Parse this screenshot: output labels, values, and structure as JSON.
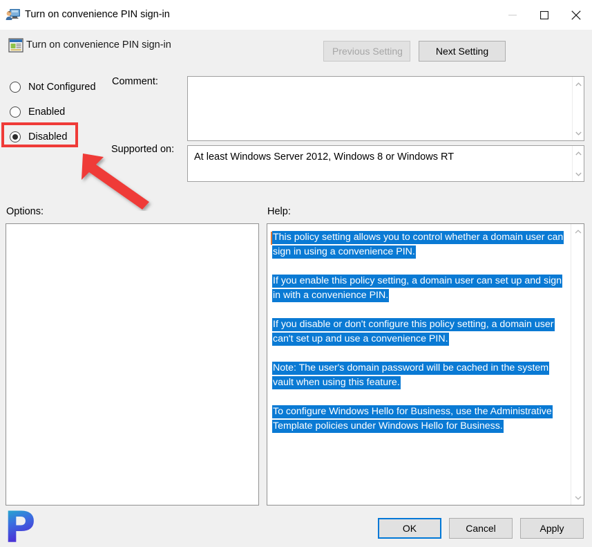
{
  "window": {
    "title": "Turn on convenience PIN sign-in",
    "icon": "policy-user-monitor-icon",
    "controls": {
      "minimize": "minimize-icon",
      "maximize": "maximize-icon",
      "close": "close-icon"
    }
  },
  "header": {
    "icon": "policy-setting-icon",
    "title": "Turn on convenience PIN sign-in",
    "previous_setting_label": "Previous Setting",
    "next_setting_label": "Next Setting",
    "previous_setting_enabled": false,
    "next_setting_enabled": true
  },
  "state_options": [
    {
      "label": "Not Configured",
      "selected": false
    },
    {
      "label": "Enabled",
      "selected": false
    },
    {
      "label": "Disabled",
      "selected": true
    }
  ],
  "fields": {
    "comment_label": "Comment:",
    "comment_value": "",
    "supported_on_label": "Supported on:",
    "supported_on_value": "At least Windows Server 2012, Windows 8 or Windows RT"
  },
  "panels": {
    "options_label": "Options:",
    "options_content": "",
    "help_label": "Help:"
  },
  "help_paragraphs": [
    "This policy setting allows you to control whether a domain user can sign in using a convenience PIN.",
    "If you enable this policy setting, a domain user can set up and sign in with a convenience PIN.",
    "If you disable or don't configure this policy setting, a domain user can't set up and use a convenience PIN.",
    "Note: The user's domain password will be cached in the system vault when using this feature.",
    "To configure Windows Hello for Business, use the Administrative Template policies under Windows Hello for Business."
  ],
  "footer": {
    "ok_label": "OK",
    "cancel_label": "Cancel",
    "apply_label": "Apply"
  },
  "watermark": {
    "text": "P"
  },
  "annotations": {
    "highlight_color": "#ef3b38",
    "arrow_color": "#ef3b38",
    "highlight_target": "Disabled",
    "selection_color": "#0a7ad4",
    "focus_color": "#0078d7"
  }
}
